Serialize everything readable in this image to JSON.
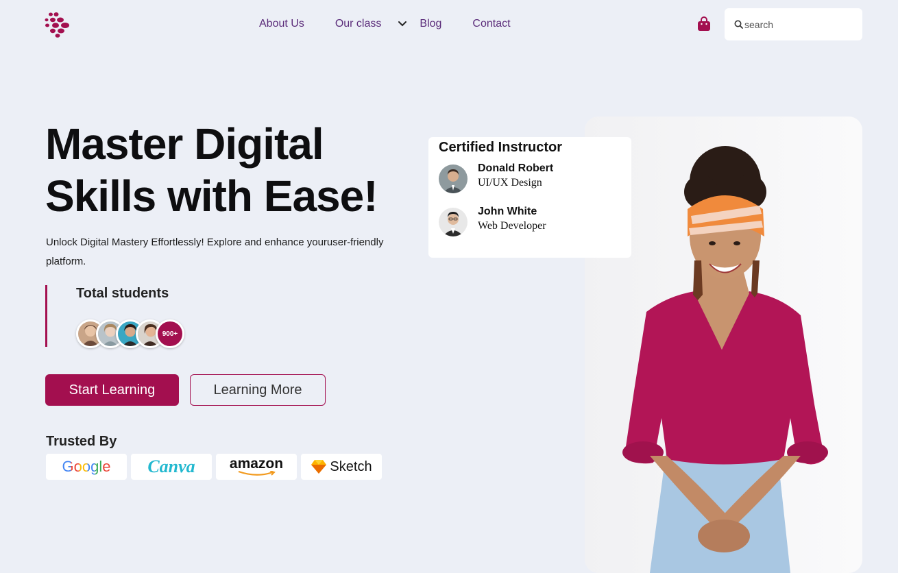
{
  "nav": {
    "items": [
      {
        "label": "About Us"
      },
      {
        "label": "Our class"
      },
      {
        "label": "Blog"
      },
      {
        "label": "Contact"
      }
    ]
  },
  "search": {
    "placeholder": "search"
  },
  "hero": {
    "title_line1": "Master Digital",
    "title_line2": "Skills with Ease!",
    "subtitle": "Unlock Digital Mastery Effortlessly! Explore and enhance youruser-friendly platform."
  },
  "students": {
    "title": "Total students",
    "count_badge": "900+"
  },
  "buttons": {
    "primary": "Start Learning",
    "secondary": "Learning More"
  },
  "trusted": {
    "title": "Trusted By",
    "brands": [
      "Google",
      "Canva",
      "amazon",
      "Sketch"
    ]
  },
  "instructors": {
    "title": "Certified Instructor",
    "people": [
      {
        "name": "Donald Robert",
        "role": "UI/UX Design"
      },
      {
        "name": "John White",
        "role": "Web Developer"
      }
    ]
  },
  "colors": {
    "accent": "#A30F4F",
    "nav_text": "#5B2C7A",
    "background": "#ECEFF6"
  }
}
